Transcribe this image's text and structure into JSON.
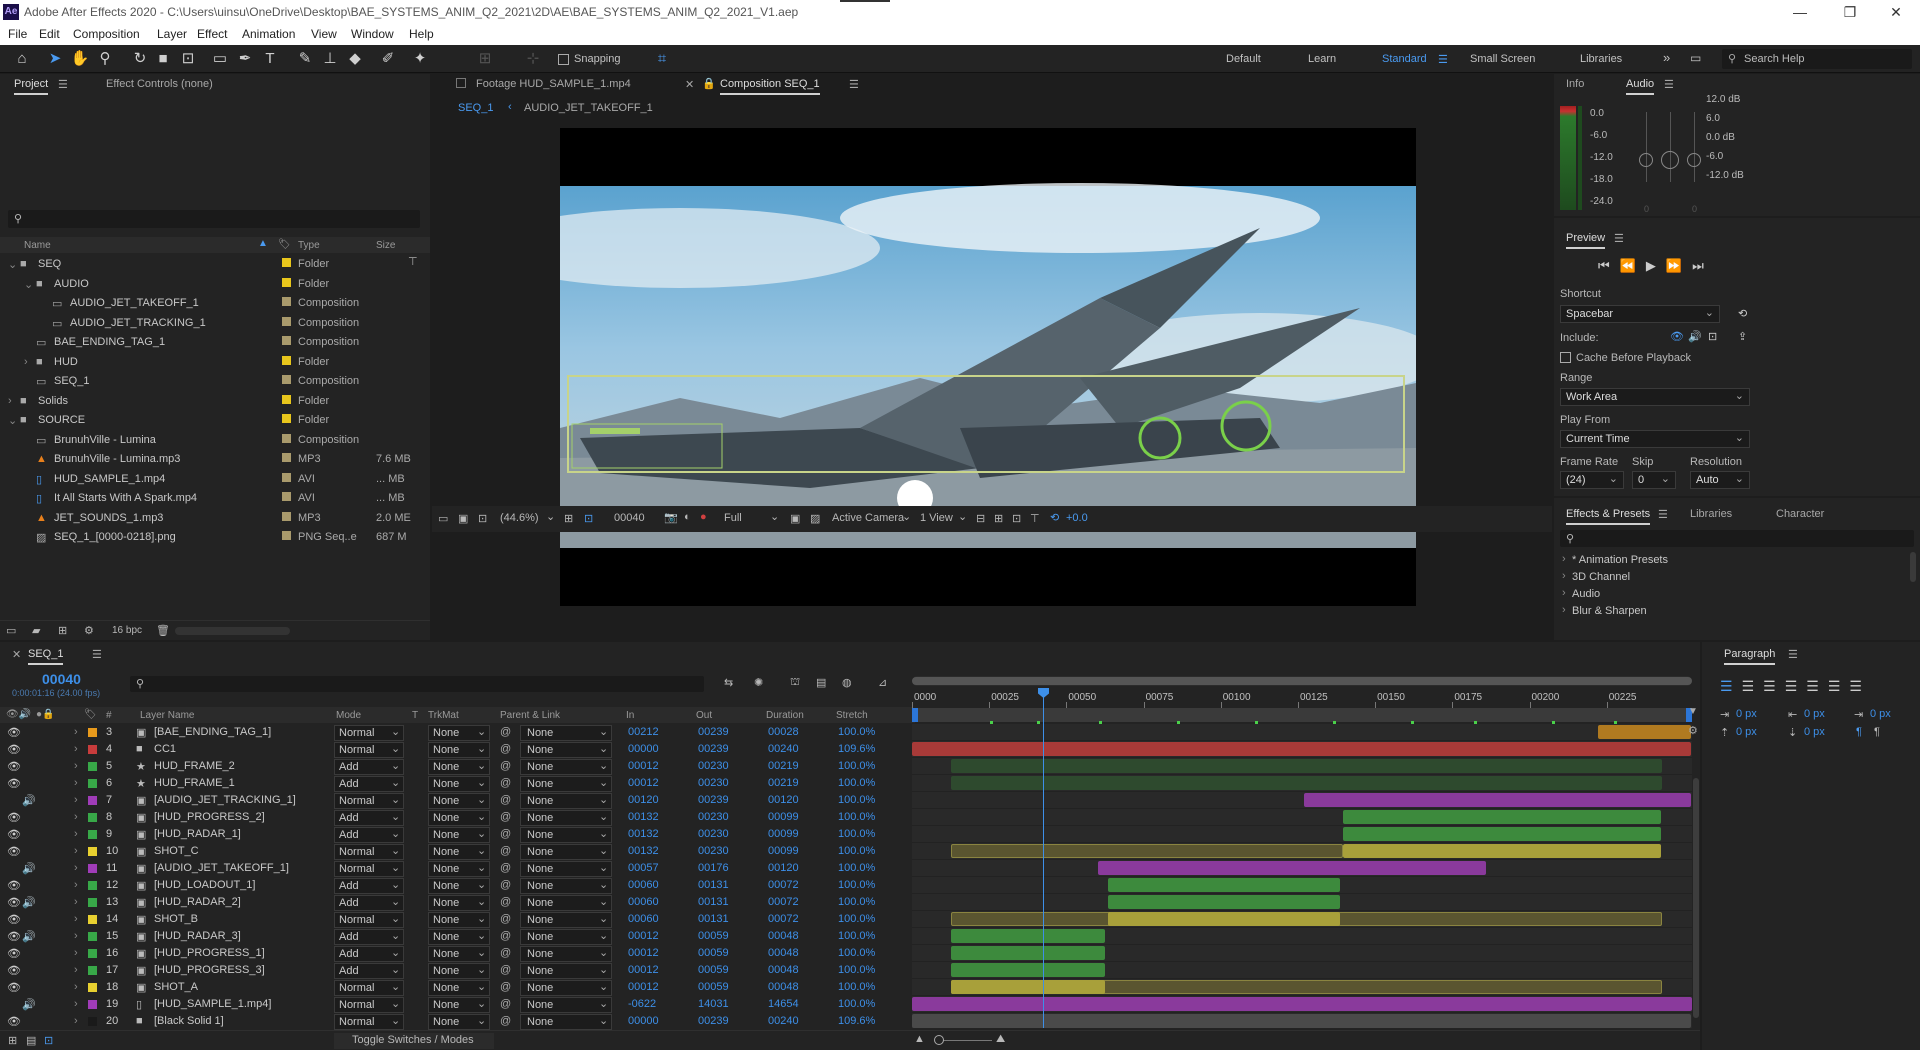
{
  "window": {
    "title": "Adobe After Effects 2020 - C:\\Users\\uinsu\\OneDrive\\Desktop\\BAE_SYSTEMS_ANIM_Q2_2021\\2D\\AE\\BAE_SYSTEMS_ANIM_Q2_2021_V1.aep",
    "logo": "Ae"
  },
  "menu": [
    "File",
    "Edit",
    "Composition",
    "Layer",
    "Effect",
    "Animation",
    "View",
    "Window",
    "Help"
  ],
  "toolbar": {
    "snapping": "Snapping",
    "workspaces": [
      "Default",
      "Learn",
      "Standard",
      "Small Screen",
      "Libraries"
    ],
    "active_workspace": "Standard",
    "search_placeholder": "Search Help"
  },
  "project": {
    "tabs": [
      "Project",
      "Effect Controls (none)"
    ],
    "cols": [
      "Name",
      "Type",
      "Size"
    ],
    "items": [
      {
        "name": "SEQ",
        "type": "Folder",
        "size": "",
        "kind": "folder",
        "depth": 0,
        "open": true,
        "color": "#e8c61c"
      },
      {
        "name": "AUDIO",
        "type": "Folder",
        "size": "",
        "kind": "folder",
        "depth": 1,
        "open": true,
        "color": "#e8c61c"
      },
      {
        "name": "AUDIO_JET_TAKEOFF_1",
        "type": "Composition",
        "size": "",
        "kind": "comp",
        "depth": 2,
        "color": "#a99a6c"
      },
      {
        "name": "AUDIO_JET_TRACKING_1",
        "type": "Composition",
        "size": "",
        "kind": "comp",
        "depth": 2,
        "color": "#a99a6c"
      },
      {
        "name": "BAE_ENDING_TAG_1",
        "type": "Composition",
        "size": "",
        "kind": "comp",
        "depth": 1,
        "color": "#a99a6c"
      },
      {
        "name": "HUD",
        "type": "Folder",
        "size": "",
        "kind": "folder",
        "depth": 1,
        "open": false,
        "color": "#e8c61c"
      },
      {
        "name": "SEQ_1",
        "type": "Composition",
        "size": "",
        "kind": "comp",
        "depth": 1,
        "color": "#a99a6c"
      },
      {
        "name": "Solids",
        "type": "Folder",
        "size": "",
        "kind": "folder",
        "depth": 0,
        "open": false,
        "color": "#e8c61c"
      },
      {
        "name": "SOURCE",
        "type": "Folder",
        "size": "",
        "kind": "folder",
        "depth": 0,
        "open": true,
        "color": "#e8c61c"
      },
      {
        "name": "BrunuhVille - Lumina",
        "type": "Composition",
        "size": "",
        "kind": "comp",
        "depth": 1,
        "color": "#a99a6c"
      },
      {
        "name": "BrunuhVille - Lumina.mp3",
        "type": "MP3",
        "size": "7.6 MB",
        "kind": "mp3",
        "depth": 1,
        "color": "#a99a6c"
      },
      {
        "name": "HUD_SAMPLE_1.mp4",
        "type": "AVI",
        "size": "... MB",
        "kind": "video",
        "depth": 1,
        "color": "#a99a6c"
      },
      {
        "name": "It All Starts With A Spark.mp4",
        "type": "AVI",
        "size": "... MB",
        "kind": "video",
        "depth": 1,
        "color": "#a99a6c"
      },
      {
        "name": "JET_SOUNDS_1.mp3",
        "type": "MP3",
        "size": "2.0 ME",
        "kind": "mp3",
        "depth": 1,
        "color": "#a99a6c"
      },
      {
        "name": "SEQ_1_[0000-0218].png",
        "type": "PNG Seq..e",
        "size": "687 M",
        "kind": "png",
        "depth": 1,
        "color": "#a99a6c"
      }
    ],
    "bpc": "16 bpc"
  },
  "viewer": {
    "tabs": [
      "Footage HUD_SAMPLE_1.mp4",
      "Composition SEQ_1"
    ],
    "subtabs": [
      "SEQ_1",
      "AUDIO_JET_TAKEOFF_1"
    ],
    "zoom": "(44.6%)",
    "timecode": "00040",
    "resolution": "Full",
    "camera": "Active Camera",
    "views": "1 View",
    "exposure": "+0.0"
  },
  "info": {
    "tabs": [
      "Info",
      "Audio"
    ],
    "left_scale": [
      "0.0",
      "-6.0",
      "-12.0",
      "-18.0",
      "-24.0"
    ],
    "right_scale": [
      "12.0 dB",
      "6.0",
      "0.0 dB",
      "-6.0",
      "-12.0 dB"
    ],
    "zeros": [
      "0",
      "0"
    ]
  },
  "preview": {
    "title": "Preview",
    "shortcut_label": "Shortcut",
    "shortcut": "Spacebar",
    "include": "Include:",
    "cache": "Cache Before Playback",
    "range_label": "Range",
    "range": "Work Area",
    "playfrom_label": "Play From",
    "playfrom": "Current Time",
    "fr_label": "Frame Rate",
    "skip_label": "Skip",
    "res_label": "Resolution",
    "fr": "(24)",
    "skip": "0",
    "res": "Auto"
  },
  "effects": {
    "tabs": [
      "Effects & Presets",
      "Libraries",
      "Character"
    ],
    "items": [
      "* Animation Presets",
      "3D Channel",
      "Audio",
      "Blur & Sharpen"
    ]
  },
  "timeline": {
    "tab": "SEQ_1",
    "timecode": "00040",
    "sub": "0:00:01:16 (24.00 fps)",
    "cols": [
      "Layer Name",
      "Mode",
      "T",
      "TrkMat",
      "Parent & Link",
      "In",
      "Out",
      "Duration",
      "Stretch"
    ],
    "ruler": [
      "0000",
      "00025",
      "00050",
      "00075",
      "00100",
      "00125",
      "00150",
      "00175",
      "00200",
      "00225"
    ],
    "toggle": "Toggle Switches / Modes",
    "layers": [
      {
        "num": "3",
        "name": "[BAE_ENDING_TAG_1]",
        "mode": "Normal",
        "trk": "None",
        "parent": "None",
        "in": "00212",
        "out": "00239",
        "dur": "00028",
        "str": "100.0%",
        "color": "#e89a1c",
        "icon": "comp",
        "eye": true,
        "spk": false,
        "bs": 0.8795,
        "be": 0.9983,
        "bcol": "#b07a20"
      },
      {
        "num": "4",
        "name": "CC1",
        "mode": "Normal",
        "trk": "None",
        "parent": "None",
        "in": "00000",
        "out": "00239",
        "dur": "00240",
        "str": "109.6%",
        "color": "#c83c3c",
        "icon": "solid",
        "eye": true,
        "spk": false,
        "bs": 0.0,
        "be": 0.9983,
        "bcol": "#a83a38"
      },
      {
        "num": "5",
        "name": "HUD_FRAME_2",
        "mode": "Add",
        "trk": "None",
        "parent": "None",
        "in": "00012",
        "out": "00230",
        "dur": "00219",
        "str": "100.0%",
        "color": "#38a848",
        "icon": "shape",
        "eye": true,
        "spk": false,
        "bs": 0.05,
        "be": 0.9609,
        "bcol": "#2e4a2e"
      },
      {
        "num": "6",
        "name": "HUD_FRAME_1",
        "mode": "Add",
        "trk": "None",
        "parent": "None",
        "in": "00012",
        "out": "00230",
        "dur": "00219",
        "str": "100.0%",
        "color": "#38a848",
        "icon": "shape",
        "eye": true,
        "spk": false,
        "bs": 0.05,
        "be": 0.9609,
        "bcol": "#2e4a2e"
      },
      {
        "num": "7",
        "name": "[AUDIO_JET_TRACKING_1]",
        "mode": "Normal",
        "trk": "None",
        "parent": "None",
        "in": "00120",
        "out": "00239",
        "dur": "00120",
        "str": "100.0%",
        "color": "#a03cb8",
        "icon": "comp",
        "eye": false,
        "spk": true,
        "bs": 0.5021,
        "be": 0.9983,
        "bcol": "#8a3a9c"
      },
      {
        "num": "8",
        "name": "[HUD_PROGRESS_2]",
        "mode": "Add",
        "trk": "None",
        "parent": "None",
        "in": "00132",
        "out": "00230",
        "dur": "00099",
        "str": "100.0%",
        "color": "#38a848",
        "icon": "comp",
        "eye": true,
        "spk": false,
        "bs": 0.5523,
        "be": 0.9609,
        "bcol": "#3d8a3d"
      },
      {
        "num": "9",
        "name": "[HUD_RADAR_1]",
        "mode": "Add",
        "trk": "None",
        "parent": "None",
        "in": "00132",
        "out": "00230",
        "dur": "00099",
        "str": "100.0%",
        "color": "#38a848",
        "icon": "comp",
        "eye": true,
        "spk": false,
        "bs": 0.5523,
        "be": 0.9609,
        "bcol": "#3d8a3d"
      },
      {
        "num": "10",
        "name": "SHOT_C",
        "mode": "Normal",
        "trk": "None",
        "parent": "None",
        "in": "00132",
        "out": "00230",
        "dur": "00099",
        "str": "100.0%",
        "color": "#e8d030",
        "icon": "comp",
        "eye": true,
        "spk": false,
        "bs": 0.5523,
        "be": 0.9609,
        "bcol": "#a8a03a",
        "ghost": [
          0.05,
          0.5523
        ]
      },
      {
        "num": "11",
        "name": "[AUDIO_JET_TAKEOFF_1]",
        "mode": "Normal",
        "trk": "None",
        "parent": "None",
        "in": "00057",
        "out": "00176",
        "dur": "00120",
        "str": "100.0%",
        "color": "#a03cb8",
        "icon": "comp",
        "eye": false,
        "spk": true,
        "bs": 0.2385,
        "be": 0.7364,
        "bcol": "#8a3a9c"
      },
      {
        "num": "12",
        "name": "[HUD_LOADOUT_1]",
        "mode": "Add",
        "trk": "None",
        "parent": "None",
        "in": "00060",
        "out": "00131",
        "dur": "00072",
        "str": "100.0%",
        "color": "#38a848",
        "icon": "comp",
        "eye": true,
        "spk": false,
        "bs": 0.251,
        "be": 0.5481,
        "bcol": "#3d8a3d"
      },
      {
        "num": "13",
        "name": "[HUD_RADAR_2]",
        "mode": "Add",
        "trk": "None",
        "parent": "None",
        "in": "00060",
        "out": "00131",
        "dur": "00072",
        "str": "100.0%",
        "color": "#38a848",
        "icon": "comp",
        "eye": true,
        "spk": true,
        "bs": 0.251,
        "be": 0.5481,
        "bcol": "#3d8a3d"
      },
      {
        "num": "14",
        "name": "SHOT_B",
        "mode": "Normal",
        "trk": "None",
        "parent": "None",
        "in": "00060",
        "out": "00131",
        "dur": "00072",
        "str": "100.0%",
        "color": "#e8d030",
        "icon": "comp",
        "eye": true,
        "spk": false,
        "bs": 0.251,
        "be": 0.5481,
        "bcol": "#a8a03a",
        "ghost": [
          0.05,
          0.9609
        ]
      },
      {
        "num": "15",
        "name": "[HUD_RADAR_3]",
        "mode": "Add",
        "trk": "None",
        "parent": "None",
        "in": "00012",
        "out": "00059",
        "dur": "00048",
        "str": "100.0%",
        "color": "#38a848",
        "icon": "comp",
        "eye": true,
        "spk": true,
        "bs": 0.05,
        "be": 0.2469,
        "bcol": "#3d8a3d"
      },
      {
        "num": "16",
        "name": "[HUD_PROGRESS_1]",
        "mode": "Add",
        "trk": "None",
        "parent": "None",
        "in": "00012",
        "out": "00059",
        "dur": "00048",
        "str": "100.0%",
        "color": "#38a848",
        "icon": "comp",
        "eye": true,
        "spk": false,
        "bs": 0.05,
        "be": 0.2469,
        "bcol": "#3d8a3d"
      },
      {
        "num": "17",
        "name": "[HUD_PROGRESS_3]",
        "mode": "Add",
        "trk": "None",
        "parent": "None",
        "in": "00012",
        "out": "00059",
        "dur": "00048",
        "str": "100.0%",
        "color": "#38a848",
        "icon": "comp",
        "eye": true,
        "spk": false,
        "bs": 0.05,
        "be": 0.2469,
        "bcol": "#3d8a3d"
      },
      {
        "num": "18",
        "name": "SHOT_A",
        "mode": "Normal",
        "trk": "None",
        "parent": "None",
        "in": "00012",
        "out": "00059",
        "dur": "00048",
        "str": "100.0%",
        "color": "#e8d030",
        "icon": "comp",
        "eye": true,
        "spk": false,
        "bs": 0.05,
        "be": 0.2469,
        "bcol": "#a8a03a",
        "ghost": [
          0.05,
          0.9609
        ]
      },
      {
        "num": "19",
        "name": "[HUD_SAMPLE_1.mp4]",
        "mode": "Normal",
        "trk": "None",
        "parent": "None",
        "in": "-0622",
        "out": "14031",
        "dur": "14654",
        "str": "100.0%",
        "color": "#a03cb8",
        "icon": "video",
        "eye": false,
        "spk": true,
        "bs": 0.0,
        "be": 1.0,
        "bcol": "#8a3a9c"
      },
      {
        "num": "20",
        "name": "[Black Solid 1]",
        "mode": "Normal",
        "trk": "None",
        "parent": "None",
        "in": "00000",
        "out": "00239",
        "dur": "00240",
        "str": "109.6%",
        "color": "#1a1a1a",
        "icon": "solid",
        "eye": true,
        "spk": false,
        "bs": 0.0,
        "be": 0.9983,
        "bcol": "#4a4a4a"
      }
    ]
  },
  "paragraph": {
    "title": "Paragraph",
    "px": [
      "0 px",
      "0 px",
      "0 px",
      "0 px",
      "0 px"
    ]
  }
}
